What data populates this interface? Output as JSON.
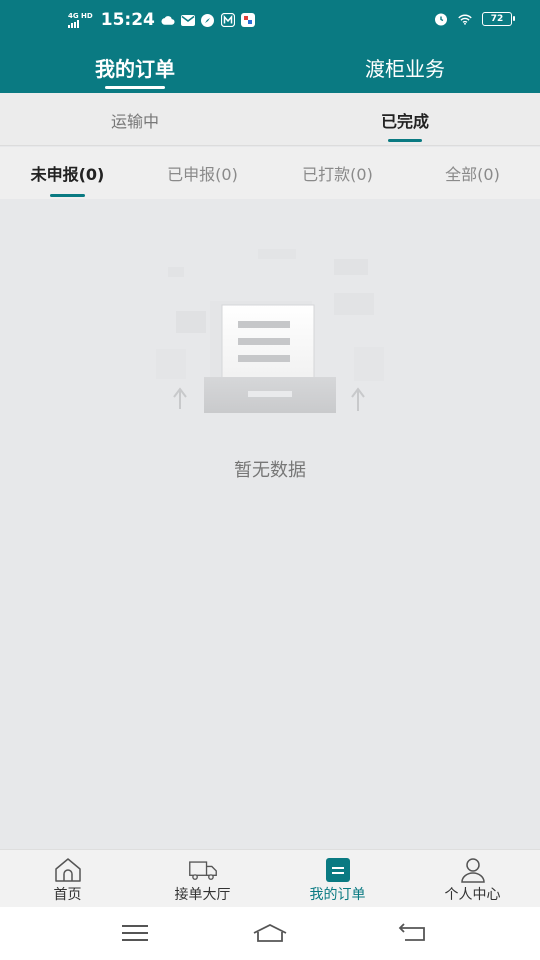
{
  "status_bar": {
    "network": "4G HD",
    "time": "15:24",
    "battery": "72",
    "icons": [
      "cloud-icon",
      "mail-icon",
      "compass-icon",
      "m-app-icon",
      "app-icon",
      "alarm-icon",
      "wifi-icon",
      "battery-icon"
    ]
  },
  "header": {
    "tabs": [
      {
        "label": "我的订单",
        "active": true
      },
      {
        "label": "渡柜业务",
        "active": false
      }
    ]
  },
  "status_tabs": [
    {
      "label": "运输中",
      "active": false
    },
    {
      "label": "已完成",
      "active": true
    }
  ],
  "filter_tabs": [
    {
      "label": "未申报(0)",
      "active": true
    },
    {
      "label": "已申报(0)",
      "active": false
    },
    {
      "label": "已打款(0)",
      "active": false
    },
    {
      "label": "全部(0)",
      "active": false
    }
  ],
  "empty_state": {
    "text": "暂无数据",
    "icon": "empty-document-icon"
  },
  "bottom_nav": [
    {
      "label": "首页",
      "icon": "home-icon",
      "active": false
    },
    {
      "label": "接单大厅",
      "icon": "truck-icon",
      "active": false
    },
    {
      "label": "我的订单",
      "icon": "orders-icon",
      "active": true
    },
    {
      "label": "个人中心",
      "icon": "user-icon",
      "active": false
    }
  ],
  "system_nav": [
    "menu-icon",
    "home-icon",
    "back-icon"
  ],
  "colors": {
    "primary": "#0a7a82",
    "background": "#e7e8ea",
    "text_inactive": "#8a8a8a",
    "text_active": "#222222"
  }
}
